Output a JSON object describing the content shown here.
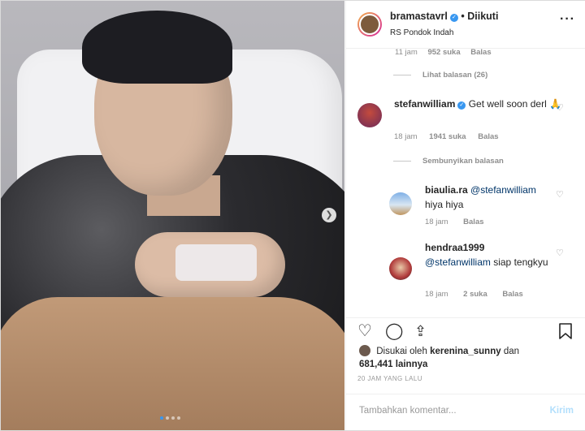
{
  "post": {
    "username": "bramastavrl",
    "follow_status": "Diikuti",
    "location": "RS Pondok Indah",
    "more_icon": "more-dots-icon"
  },
  "comments": {
    "prev_meta": {
      "time": "11 jam",
      "likes": "952 suka",
      "reply": "Balas"
    },
    "view_replies": "Lihat balasan (26)",
    "main": {
      "username": "stefanwilliam",
      "text": "Get well soon derl 🙏",
      "time": "18 jam",
      "likes": "1941 suka",
      "reply": "Balas"
    },
    "hide_replies": "Sembunyikan balasan",
    "replies": [
      {
        "username": "biaulia.ra",
        "mention": "@stefanwilliam",
        "text": "hiya hiya",
        "time": "18 jam",
        "likes": "",
        "reply": "Balas"
      },
      {
        "username": "hendraa1999",
        "mention": "@stefanwilliam",
        "text": "siap tengkyu",
        "time": "18 jam",
        "likes": "2 suka",
        "reply": "Balas"
      }
    ]
  },
  "likes": {
    "prefix": "Disukai oleh",
    "user": "kerenina_sunny",
    "connector": "dan",
    "count": "681,441 lainnya"
  },
  "time_ago": "20 JAM YANG LALU",
  "comment_input": {
    "placeholder": "Tambahkan komentar...",
    "post_label": "Kirim"
  },
  "colors": {
    "accent": "#3897f0",
    "muted": "#8e8e8e",
    "post_disabled": "#b2dffc"
  },
  "carousel": {
    "current": 1,
    "total": 4
  }
}
